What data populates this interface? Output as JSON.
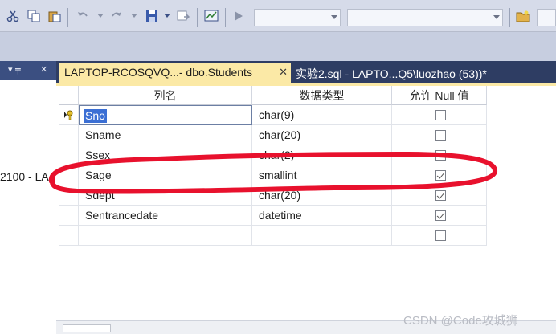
{
  "tabs": {
    "active_label": "LAPTOP-RCOSQVQ...- dbo.Students",
    "active_close": "✕",
    "second_label": "实验2.sql - LAPTO...Q5\\luozhao (53))*"
  },
  "left_pane": {
    "pin": "▾ ╤",
    "close": "✕",
    "text": "2100 - LA"
  },
  "grid": {
    "headers": [
      "列名",
      "数据类型",
      "允许 Null 值"
    ],
    "rows": [
      {
        "name": "Sno",
        "type": "char(9)",
        "allow_null": false,
        "primary_key": true,
        "editing": true
      },
      {
        "name": "Sname",
        "type": "char(20)",
        "allow_null": false
      },
      {
        "name": "Ssex",
        "type": "char(2)",
        "allow_null": false
      },
      {
        "name": "Sage",
        "type": "smallint",
        "allow_null": true
      },
      {
        "name": "Sdept",
        "type": "char(20)",
        "allow_null": true
      },
      {
        "name": "Sentrancedate",
        "type": "datetime",
        "allow_null": true
      },
      {
        "name": "",
        "type": "",
        "allow_null": false
      }
    ]
  },
  "icons": [
    "cut-icon",
    "copy-icon",
    "paste-icon",
    "undo-icon",
    "redo-icon",
    "save-icon",
    "chart-icon",
    "run-icon",
    "folder-icon",
    "key-icon"
  ],
  "colors": {
    "annotation": "#e8112d",
    "active_tab": "#fbe9a6",
    "tab_bar": "#2e3d63"
  },
  "watermark": "CSDN @Code攻城狮"
}
